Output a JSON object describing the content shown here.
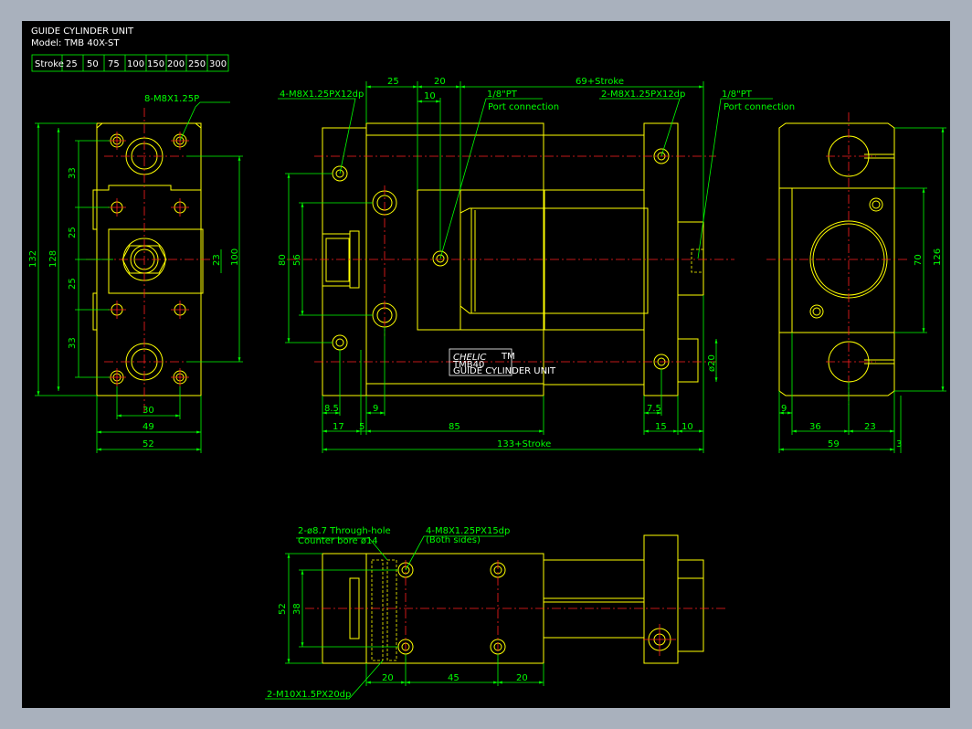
{
  "title": {
    "name": "GUIDE CYLINDER UNIT",
    "model": "Model: TMB 40X-ST"
  },
  "stroke_table": {
    "header": "Stroke",
    "values": [
      "25",
      "50",
      "75",
      "100",
      "150",
      "200",
      "250",
      "300"
    ]
  },
  "front_view": {
    "callout": "8-M8X1.25P",
    "dims_left": [
      "132",
      "128",
      "33",
      "25",
      "25",
      "33"
    ],
    "dims_right": [
      "100",
      "23"
    ],
    "dims_bottom": [
      "30",
      "49",
      "52"
    ]
  },
  "side_view": {
    "callout_tap_left": "4-M8X1.25PX12dp",
    "callout_port_left": "1/8\"PT",
    "port_note_left": "Port connection",
    "callout_tap_right": "2-M8X1.25PX12dp",
    "callout_port_right": "1/8\"PT",
    "port_note_right": "Port connection",
    "dim_top_25": "25",
    "dim_top_20": "20",
    "dim_top_10": "10",
    "dim_top_stroke": "69+Stroke",
    "dim_80": "80",
    "dim_56": "56",
    "dim_20": "ø20",
    "dim_8_5": "8.5",
    "dim_9": "9",
    "dim_7_5": "7.5",
    "dim_17": "17",
    "dim_5": "5",
    "dim_85": "85",
    "dim_15": "15",
    "dim_10": "10",
    "dim_total": "133+Stroke",
    "brand": "CHELIC",
    "brand_mark": "TM",
    "plate_model": "TMB40",
    "plate_name": "GUIDE CYLINDER UNIT"
  },
  "end_view": {
    "dim_70": "70",
    "dim_126": "126",
    "dim_9": "9",
    "dim_36": "36",
    "dim_23": "23",
    "dim_59": "59",
    "dim_3": "3"
  },
  "bottom_view": {
    "callout_through": "2-ø8.7 Through-hole",
    "callout_counter": "Counter bore  ø14",
    "callout_tap": "4-M8X1.25PX15dp",
    "callout_tap_note": "(Both sides)",
    "callout_thread": "2-M10X1.5PX20dp",
    "dim_52": "52",
    "dim_38": "38",
    "dim_20a": "20",
    "dim_45": "45",
    "dim_20b": "20"
  },
  "colors": {
    "background": "#000000",
    "frame": "#a9b1bd",
    "outline": "#ffff00",
    "dimension": "#00ff00",
    "centerline": "#ff2020",
    "text": "#ffffff"
  }
}
